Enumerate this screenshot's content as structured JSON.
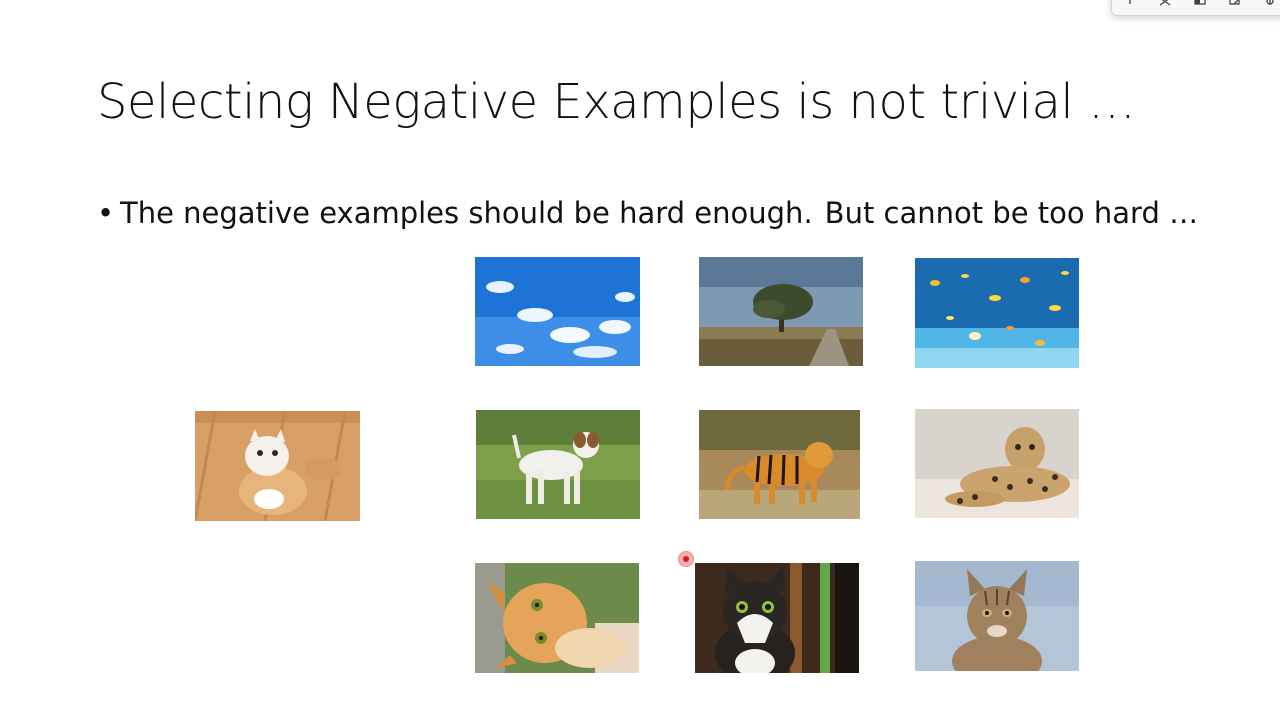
{
  "slide": {
    "title": "Selecting Negative Examples is not trivial …",
    "bullet": {
      "marker": "•",
      "part1": "The negative examples should be hard enough.",
      "part2": "But cannot be too hard …"
    }
  },
  "images": {
    "anchor": "cat-sitting-on-floor",
    "row1": [
      "blue-sky-with-clouds",
      "tree-in-field",
      "underwater-fish"
    ],
    "row2": [
      "white-dog-on-grass",
      "tiger",
      "leopard-lying"
    ],
    "row3": [
      "orange-kitten-head-tilt",
      "tabby-cat-looking-up",
      "tabby-cat-portrait"
    ]
  },
  "toolbar": {
    "icons": [
      "pin-icon",
      "scissors-icon",
      "window-icon",
      "edit-icon",
      "settings-icon"
    ]
  },
  "colors": {
    "pointer": "#d81b1b",
    "title_text": "#111111"
  }
}
